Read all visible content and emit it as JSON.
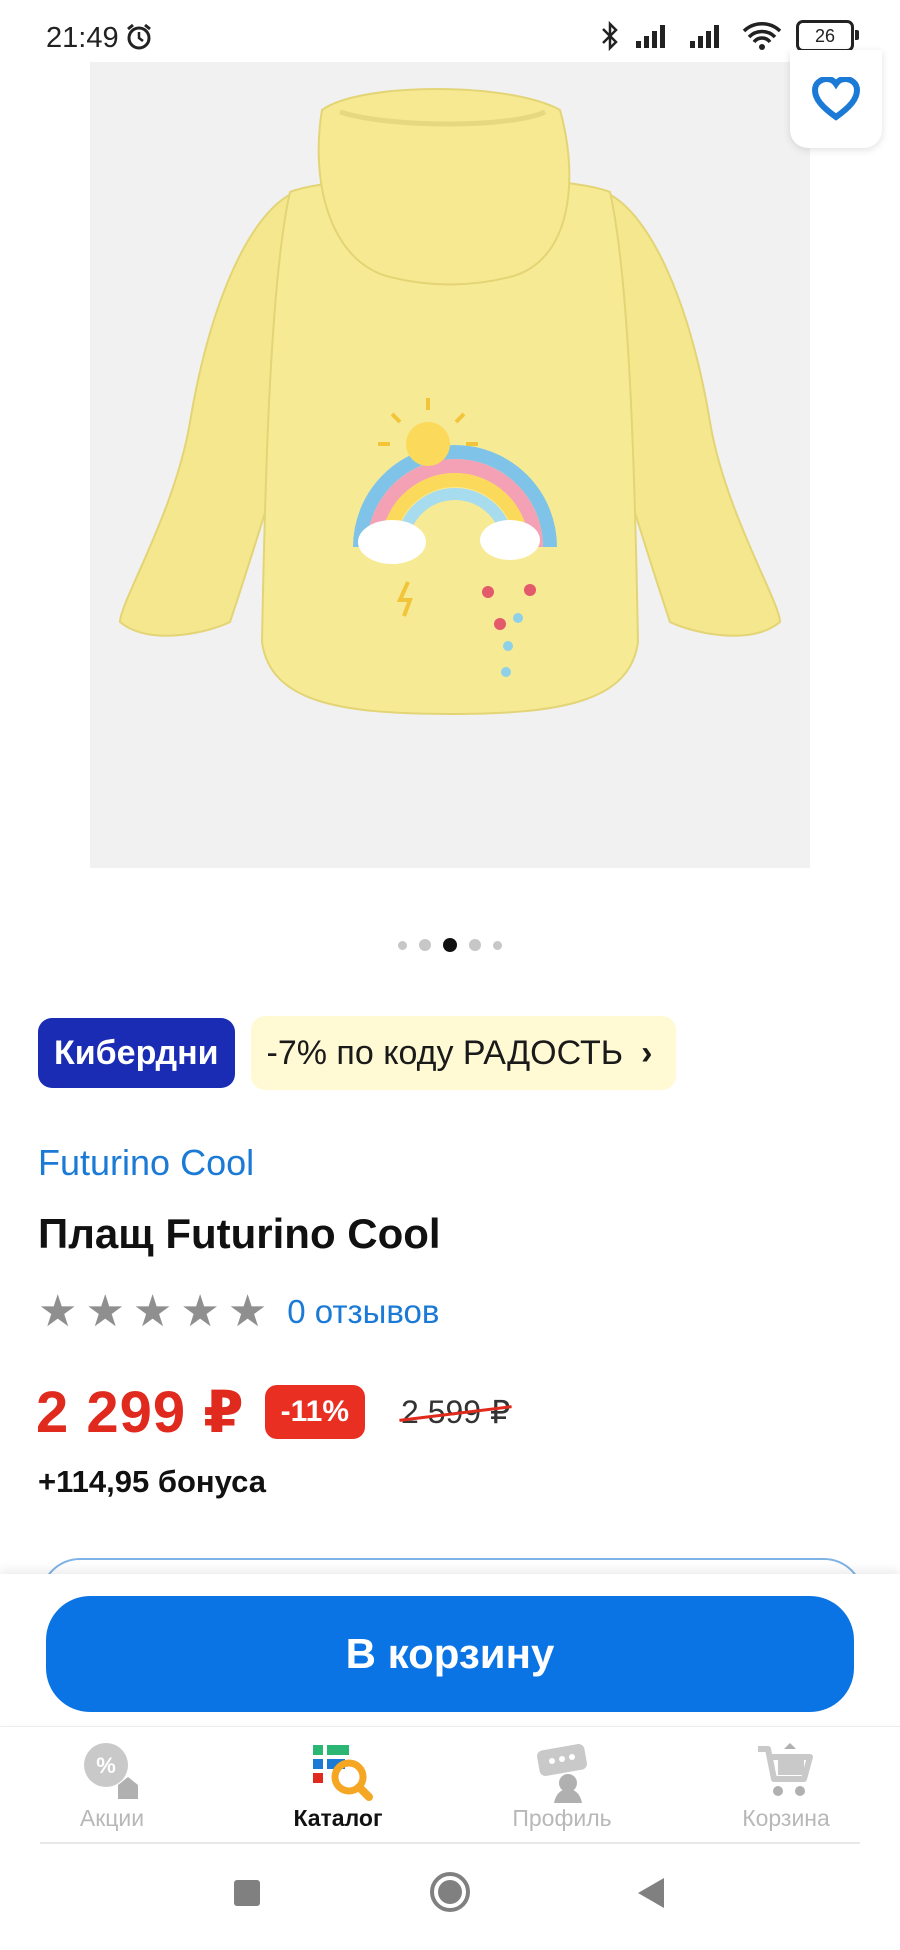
{
  "status_bar": {
    "time": "21:49",
    "battery": "26",
    "icons": [
      "alarm-icon",
      "bluetooth-icon",
      "signal-icon",
      "signal-icon",
      "wifi-icon",
      "battery-icon"
    ]
  },
  "product": {
    "image_slides": 5,
    "active_slide": 3,
    "favorite_icon": "heart-icon",
    "badge": "Кибердни",
    "promo": "-7% по коду РАДОСТЬ",
    "brand": "Futurino Cool",
    "title": "Плащ Futurino Cool",
    "rating": 0,
    "rating_max": 5,
    "reviews": "0 отзывов",
    "price": "2 299 ₽",
    "discount": "-11%",
    "old_price": "2 599 ₽",
    "bonus": "+114,95 бонуса"
  },
  "cta": {
    "add_to_cart": "В корзину"
  },
  "bottom_nav": {
    "items": [
      {
        "label": "Акции",
        "icon": "promo-icon",
        "active": false
      },
      {
        "label": "Каталог",
        "icon": "catalog-icon",
        "active": true
      },
      {
        "label": "Профиль",
        "icon": "profile-icon",
        "active": false
      },
      {
        "label": "Корзина",
        "icon": "cart-icon",
        "active": false
      }
    ]
  },
  "colors": {
    "accent": "#0b74e4",
    "price": "#e02a1e",
    "badge": "#1a2bb4",
    "promo_bg": "#fffad4"
  }
}
